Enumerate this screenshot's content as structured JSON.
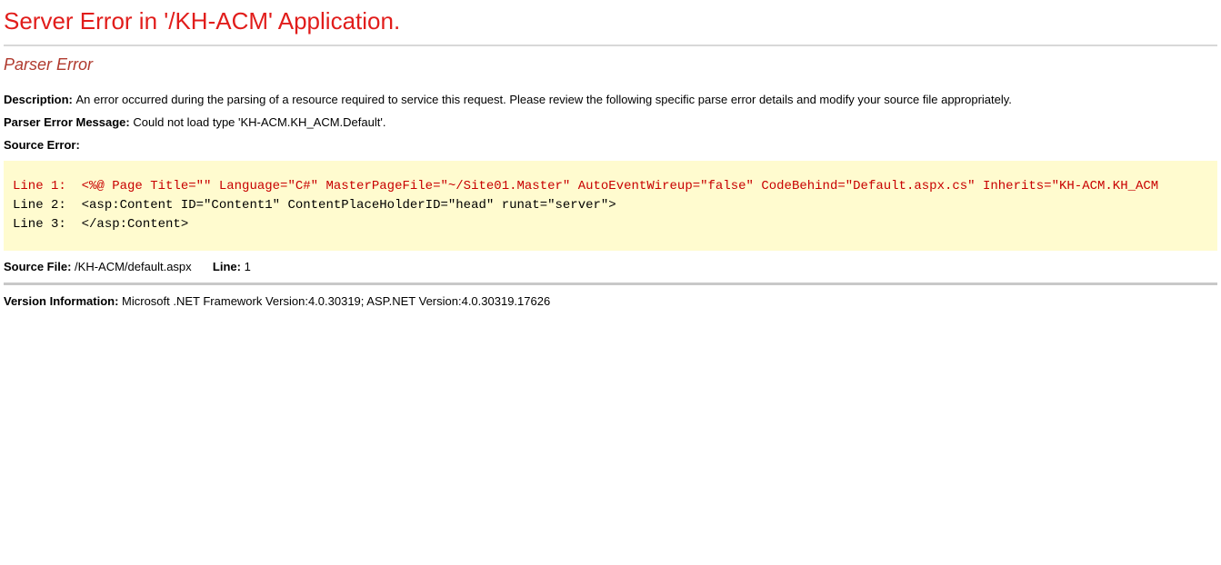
{
  "header": "Server Error in '/KH-ACM' Application.",
  "subheader": "Parser Error",
  "description": {
    "label": "Description:",
    "text": "An error occurred during the parsing of a resource required to service this request. Please review the following specific parse error details and modify your source file appropriately."
  },
  "parser_error": {
    "label": "Parser Error Message:",
    "text": "Could not load type 'KH-ACM.KH_ACM.Default'."
  },
  "source_error": {
    "label": "Source Error:",
    "lines": [
      {
        "prefix": "Line 1:  ",
        "code": "<%@ Page Title=\"\" Language=\"C#\" MasterPageFile=\"~/Site01.Master\" AutoEventWireup=\"false\" CodeBehind=\"Default.aspx.cs\" Inherits=\"KH-ACM.KH_ACM",
        "highlight": true
      },
      {
        "prefix": "Line 2:  ",
        "code": "<asp:Content ID=\"Content1\" ContentPlaceHolderID=\"head\" runat=\"server\">",
        "highlight": false
      },
      {
        "prefix": "Line 3:  ",
        "code": "</asp:Content>",
        "highlight": false
      }
    ]
  },
  "source_file": {
    "label": "Source File:",
    "path": "/KH-ACM/default.aspx",
    "line_label": "Line:",
    "line_number": "1"
  },
  "version": {
    "label": "Version Information:",
    "text": "Microsoft .NET Framework Version:4.0.30319; ASP.NET Version:4.0.30319.17626"
  }
}
